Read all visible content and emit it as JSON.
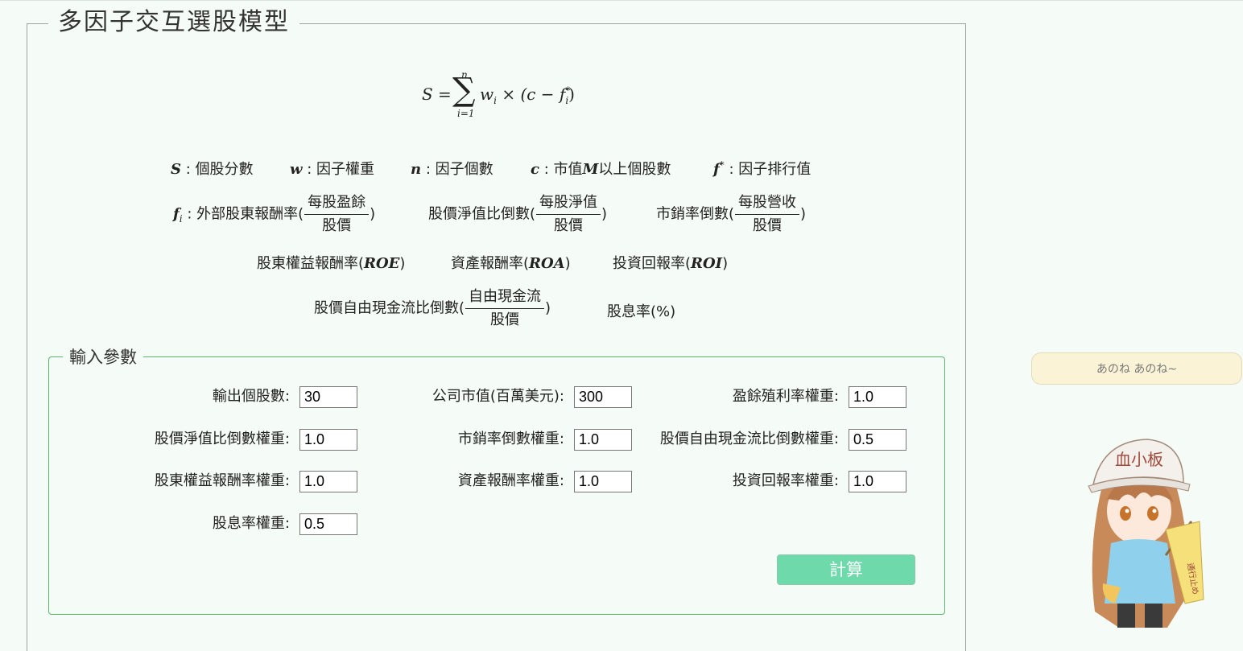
{
  "page_title": "多因子交互選股模型",
  "formula": {
    "lhs": "S =",
    "sum_upper": "n",
    "sum_lower": "i=1",
    "rhs_w": "w",
    "rhs_w_sub": "i",
    "rhs_rest_a": " × (c − f",
    "rhs_f_sup": "*",
    "rhs_f_sub": "i",
    "rhs_close": ")"
  },
  "definitions": {
    "S_sym": "S",
    "S_text": " : 個股分數",
    "w_sym": "w",
    "w_text": " : 因子權重",
    "n_sym": "n",
    "n_text": " : 因子個數",
    "c_sym": "c",
    "c_text_a": " : 市值",
    "c_M": "M",
    "c_text_b": "以上個股數",
    "f_sym": "f",
    "f_sup": "*",
    "f_text": " : 因子排行值"
  },
  "factors": {
    "fi_sym": "f",
    "fi_sub": "i",
    "earnings_yield_label": " : 外部股東報酬率(",
    "earnings_num": "每股盈餘",
    "earnings_den": "股價",
    "pb_label": "股價淨值比倒數(",
    "pb_num": "每股淨值",
    "pb_den": "股價",
    "ps_label": "市銷率倒數(",
    "ps_num": "每股營收",
    "ps_den": "股價",
    "roe_label": "股東權益報酬率(",
    "roe_sym": "ROE",
    "roa_label": "資產報酬率(",
    "roa_sym": "ROA",
    "roi_label": "投資回報率(",
    "roi_sym": "ROI",
    "pfcf_label": "股價自由現金流比倒數(",
    "pfcf_num": "自由現金流",
    "pfcf_den": "股價",
    "dy_label": "股息率(%)",
    "close_paren": ")"
  },
  "input_section": {
    "title": "輸入參數",
    "fields": [
      {
        "label": "輸出個股數:",
        "value": "30"
      },
      {
        "label": "公司市值(百萬美元):",
        "value": "300"
      },
      {
        "label": "盈餘殖利率權重:",
        "value": "1.0"
      },
      {
        "label": "股價淨值比倒數權重:",
        "value": "1.0"
      },
      {
        "label": "市銷率倒數權重:",
        "value": "1.0"
      },
      {
        "label": "股價自由現金流比倒數權重:",
        "value": "0.5"
      },
      {
        "label": "股東權益報酬率權重:",
        "value": "1.0"
      },
      {
        "label": "資產報酬率權重:",
        "value": "1.0"
      },
      {
        "label": "投資回報率權重:",
        "value": "1.0"
      },
      {
        "label": "股息率權重:",
        "value": "0.5"
      }
    ],
    "calculate_label": "計算"
  },
  "widget": {
    "bubble_text": "あのね あのね~",
    "mascot_hat_text": "血小板",
    "mascot_flag_text": "通行止め"
  }
}
